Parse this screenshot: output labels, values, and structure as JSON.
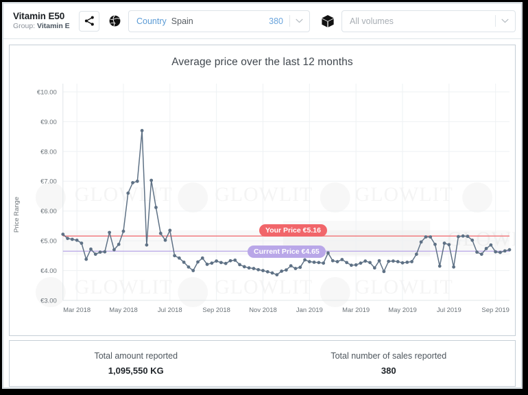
{
  "header": {
    "product_name": "Vitamin E50",
    "group_prefix": "Group: ",
    "group_name": "Vitamin E",
    "share_icon": "share-icon",
    "globe_icon": "globe-icon",
    "cube_icon": "cube-icon",
    "country_select": {
      "label": "Country",
      "value": "Spain",
      "count": "380",
      "caret": "chevron-down-icon"
    },
    "volumes_select": {
      "value": "All volumes",
      "placeholder": "All volumes",
      "caret": "chevron-down-icon"
    }
  },
  "chart_card": {
    "title": "Average price over the last 12 months",
    "your_price_badge": "Your Price €5.16",
    "current_price_badge": "Current Price €4.65",
    "watermark": "GLOWLIT"
  },
  "footer": {
    "amount_label": "Total amount reported",
    "amount_value": "1,095,550 KG",
    "sales_label": "Total number of sales reported",
    "sales_value": "380"
  },
  "colors": {
    "your_price": "#f1666a",
    "current_price": "#b9a7e8",
    "series": "#5e7185",
    "accent_link": "#5b9bd5",
    "grid": "#eef1f3"
  },
  "chart_data": {
    "type": "line",
    "title": "Average price over the last 12 months",
    "xlabel": "",
    "ylabel": "Price Range",
    "ylim": [
      3.0,
      10.0
    ],
    "ytick_labels": [
      "€3.00",
      "€4.00",
      "€5.00",
      "€6.00",
      "€7.00",
      "€8.00",
      "€9.00",
      "€10.00"
    ],
    "ytick_values": [
      3,
      4,
      5,
      6,
      7,
      8,
      9,
      10
    ],
    "xtick_labels": [
      "Mar 2018",
      "May 2018",
      "Jul 2018",
      "Sep 2018",
      "Nov 2018",
      "Jan 2019",
      "Mar 2019",
      "May 2019",
      "Jul 2019",
      "Sep 2019"
    ],
    "xtick_positions": [
      3,
      13,
      23,
      33,
      43,
      53,
      63,
      73,
      83,
      93
    ],
    "grid": true,
    "legend": "none",
    "reference_lines": [
      {
        "name": "Your Price",
        "value": 5.16,
        "color": "#f1666a",
        "label": "Your Price €5.16"
      },
      {
        "name": "Current Price",
        "value": 4.65,
        "color": "#b9a7e8",
        "label": "Current Price €4.65"
      }
    ],
    "series": [
      {
        "name": "Average price",
        "color": "#5e7185",
        "values": [
          5.22,
          5.08,
          5.05,
          5.02,
          4.92,
          4.38,
          4.72,
          4.55,
          4.62,
          4.63,
          5.28,
          4.7,
          4.88,
          5.32,
          6.6,
          6.95,
          7.0,
          8.7,
          4.86,
          7.03,
          6.12,
          5.25,
          5.02,
          5.35,
          4.5,
          4.42,
          4.28,
          4.12,
          4.0,
          4.29,
          4.42,
          4.21,
          4.25,
          4.32,
          4.27,
          4.24,
          4.33,
          4.35,
          4.2,
          4.13,
          4.09,
          4.07,
          4.03,
          4.0,
          3.96,
          3.92,
          3.86,
          3.98,
          4.02,
          4.16,
          4.07,
          4.11,
          4.36,
          4.3,
          4.28,
          4.27,
          4.25,
          4.59,
          4.33,
          4.3,
          4.37,
          4.27,
          4.18,
          4.19,
          4.25,
          4.32,
          4.27,
          4.09,
          4.33,
          3.97,
          4.31,
          4.32,
          4.3,
          4.26,
          4.28,
          4.3,
          4.55,
          4.96,
          5.13,
          5.13,
          4.88,
          4.15,
          4.92,
          4.87,
          4.12,
          5.14,
          5.16,
          5.15,
          5.02,
          4.62,
          4.55,
          4.74,
          4.86,
          4.63,
          4.61,
          4.66,
          4.7
        ]
      }
    ]
  }
}
